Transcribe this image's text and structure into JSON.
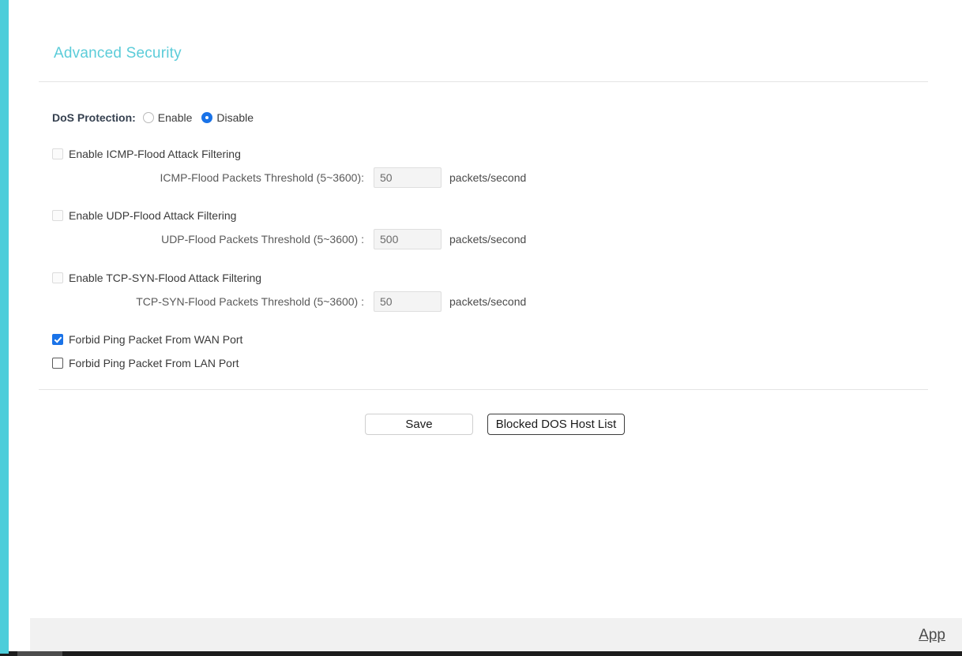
{
  "page": {
    "title": "Advanced Security",
    "accent_color": "#5bccd9",
    "rail_color": "#4ccdda"
  },
  "dos_protection": {
    "label": "DoS Protection:",
    "options": [
      {
        "label": "Enable",
        "selected": false
      },
      {
        "label": "Disable",
        "selected": true
      }
    ]
  },
  "filters": [
    {
      "checkbox_label": "Enable ICMP-Flood Attack Filtering",
      "checked": false,
      "disabled": true,
      "threshold_label": "ICMP-Flood Packets Threshold (5~3600):",
      "threshold_value": "50",
      "threshold_unit": "packets/second"
    },
    {
      "checkbox_label": "Enable UDP-Flood Attack Filtering",
      "checked": false,
      "disabled": true,
      "threshold_label": "UDP-Flood Packets Threshold (5~3600) :",
      "threshold_value": "500",
      "threshold_unit": "packets/second"
    },
    {
      "checkbox_label": "Enable TCP-SYN-Flood Attack Filtering",
      "checked": false,
      "disabled": true,
      "threshold_label": "TCP-SYN-Flood Packets Threshold (5~3600) :",
      "threshold_value": "50",
      "threshold_unit": "packets/second"
    }
  ],
  "ping_options": [
    {
      "label": "Forbid Ping Packet From WAN Port",
      "checked": true
    },
    {
      "label": "Forbid Ping Packet From LAN Port",
      "checked": false
    }
  ],
  "buttons": {
    "save": "Save",
    "blocked_host_list": "Blocked DOS Host List"
  },
  "footer": {
    "app_link": "App"
  }
}
